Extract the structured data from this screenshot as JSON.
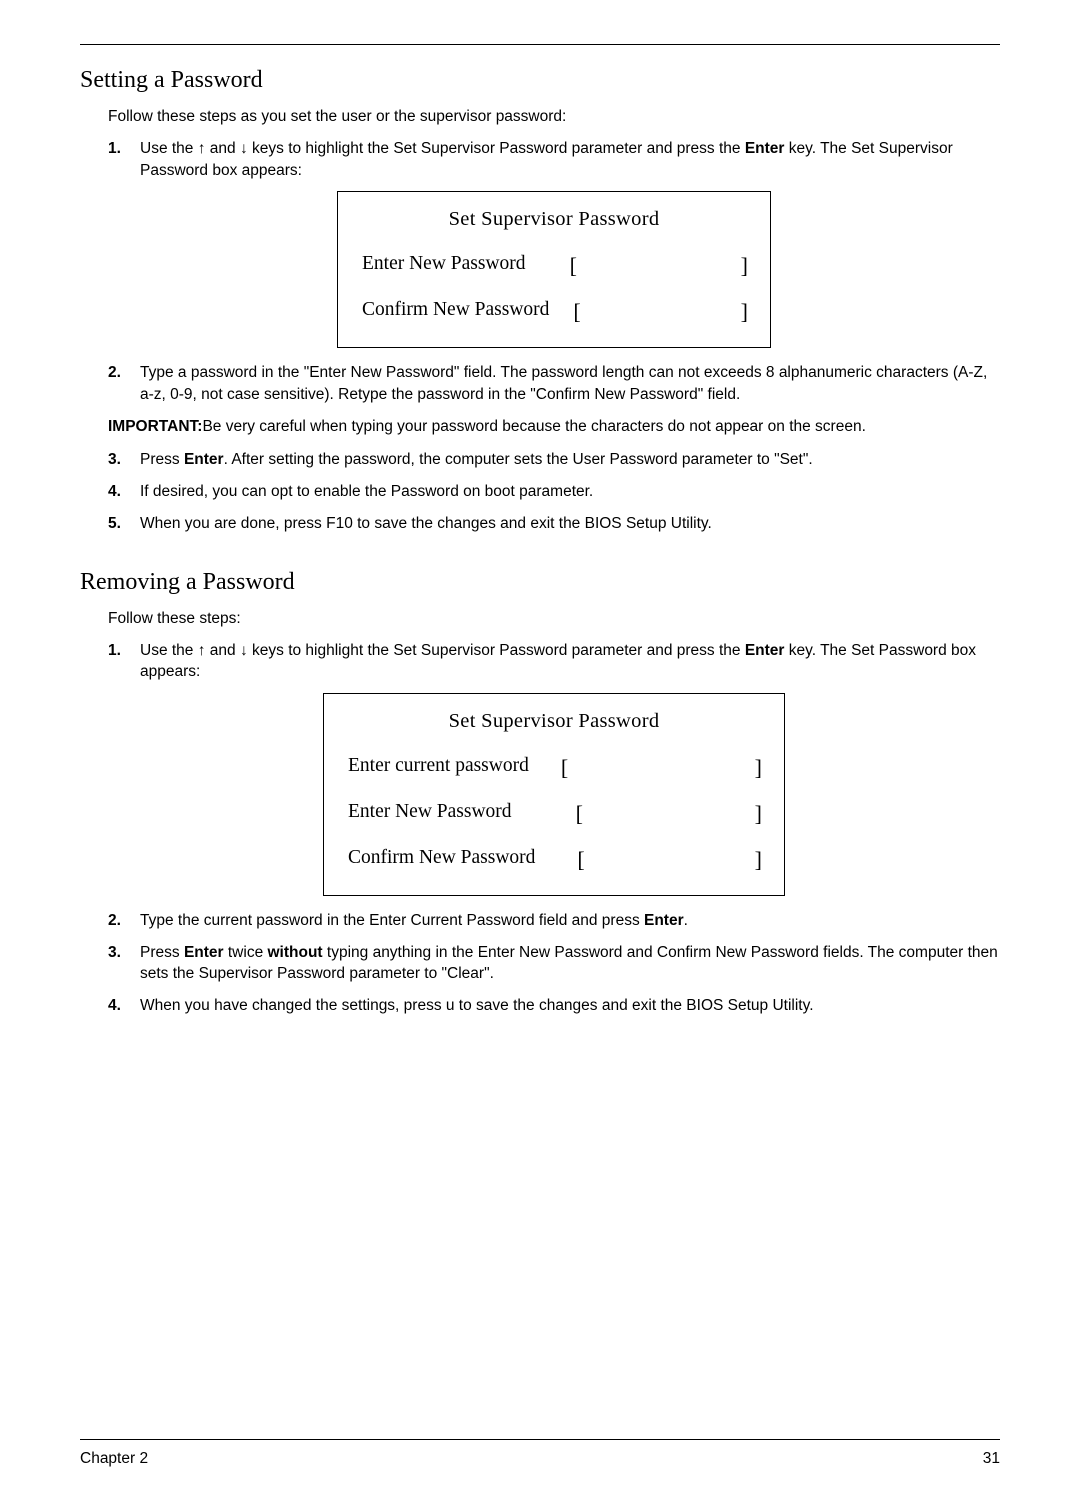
{
  "section1": {
    "heading": "Setting a Password",
    "intro": "Follow these steps as you set the user or the supervisor password:",
    "steps": {
      "n1": "1.",
      "s1_a": "Use the ",
      "s1_b": " and ",
      "s1_c": " keys to highlight the Set Supervisor Password parameter and press the ",
      "s1_d": " key. The Set Supervisor Password box appears:",
      "arrow_up": "↑",
      "arrow_down": "↓",
      "enter": "Enter",
      "n2": "2.",
      "s2": "Type a password in the \"Enter New Password\" field. The password length can not exceeds 8 alphanumeric characters (A-Z, a-z, 0-9, not case sensitive). Retype the password in the \"Confirm New Password\" field.",
      "important_label": "IMPORTANT:",
      "important_text": "Be very careful when typing your password because the characters do not appear on the screen.",
      "n3": "3.",
      "s3_a": "Press ",
      "s3_b": ". After setting the password, the computer sets the User Password parameter to \"Set\".",
      "n4": "4.",
      "s4": "If desired, you can opt to enable the Password on boot parameter.",
      "n5": "5.",
      "s5": "When you are done, press F10 to save the changes and exit the BIOS Setup Utility."
    },
    "bios": {
      "title": "Set Supervisor Password",
      "row1": "Enter New Password",
      "row2": "Confirm New Password",
      "bl": "[",
      "br": "]"
    }
  },
  "section2": {
    "heading": "Removing a Password",
    "intro": "Follow these steps:",
    "steps": {
      "n1": "1.",
      "s1_a": "Use the ",
      "s1_b": " and ",
      "s1_c": " keys to highlight the Set Supervisor Password parameter and press the ",
      "s1_d": " key. The Set Password box appears:",
      "arrow_up": "↑",
      "arrow_down": "↓",
      "enter": "Enter",
      "n2": "2.",
      "s2_a": "Type the current password in the Enter Current Password field and press ",
      "s2_b": ".",
      "n3": "3.",
      "s3_a": "Press ",
      "s3_b": " twice ",
      "s3_c": " typing anything in the Enter New Password and Confirm New Password fields. The computer then sets the Supervisor Password parameter to \"Clear\".",
      "without": "without",
      "n4": "4.",
      "s4": "When you have changed the settings, press u to save the changes and exit the BIOS Setup Utility."
    },
    "bios": {
      "title": "Set Supervisor Password",
      "row1": "Enter current password",
      "row2": "Enter New Password",
      "row3": "Confirm New Password",
      "bl": "[",
      "br": "]"
    }
  },
  "footer": {
    "left": "Chapter 2",
    "right": "31"
  }
}
